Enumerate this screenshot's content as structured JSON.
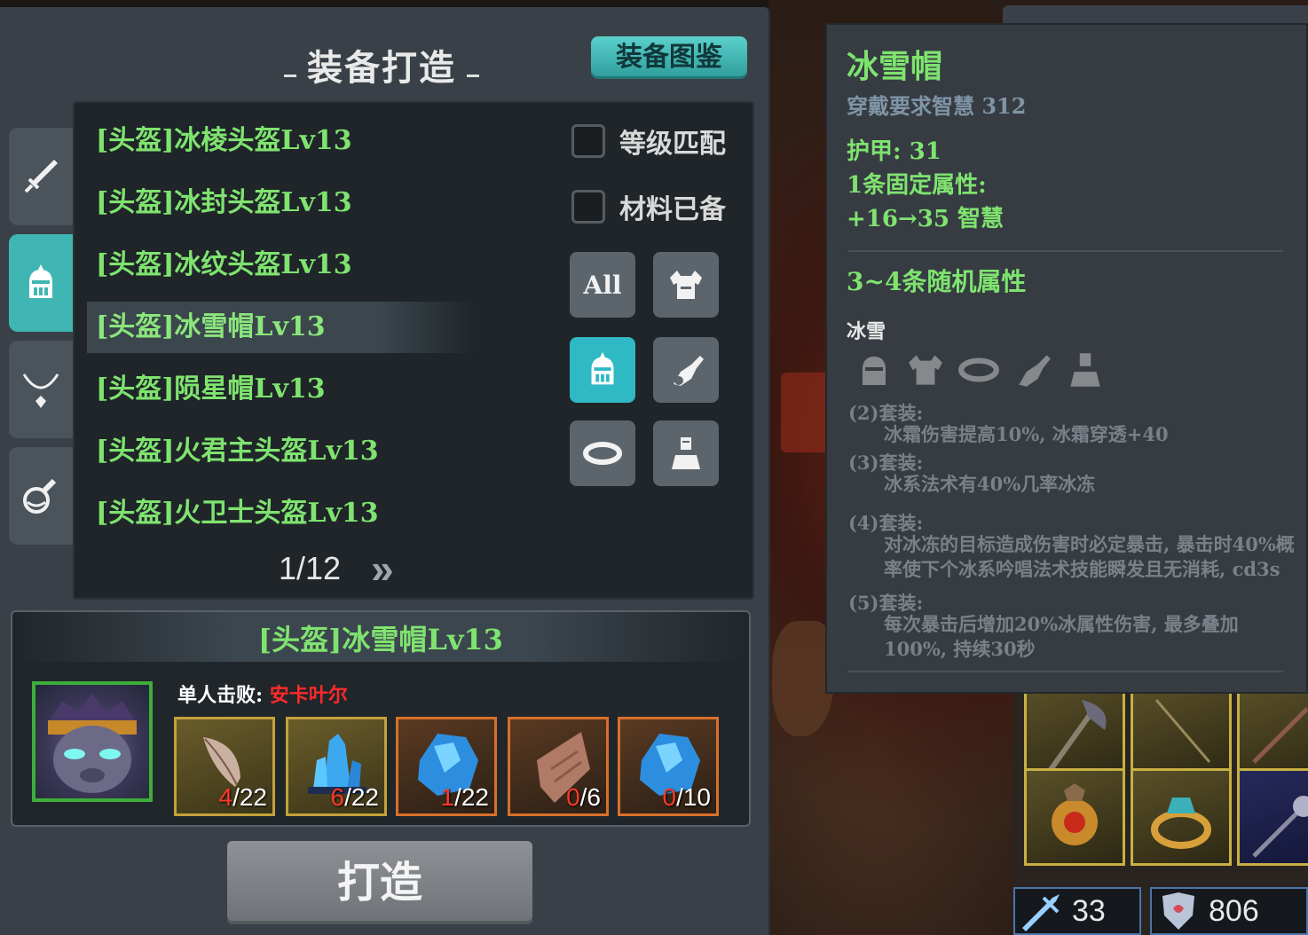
{
  "crafting": {
    "title": "装备打造",
    "codex_button": "装备图鉴",
    "category_tabs": [
      {
        "name": "weapon",
        "icon": "sword-icon",
        "active": false
      },
      {
        "name": "helmet",
        "icon": "helmet-icon",
        "active": true
      },
      {
        "name": "necklace",
        "icon": "necklace-icon",
        "active": false
      },
      {
        "name": "potion",
        "icon": "potion-icon",
        "active": false
      }
    ],
    "recipes": [
      {
        "label": "[头盔]冰棱头盔Lv13",
        "selected": false
      },
      {
        "label": "[头盔]冰封头盔Lv13",
        "selected": false
      },
      {
        "label": "[头盔]冰纹头盔Lv13",
        "selected": false
      },
      {
        "label": "[头盔]冰雪帽Lv13",
        "selected": true
      },
      {
        "label": "[头盔]陨星帽Lv13",
        "selected": false
      },
      {
        "label": "[头盔]火君主头盔Lv13",
        "selected": false
      },
      {
        "label": "[头盔]火卫士头盔Lv13",
        "selected": false
      }
    ],
    "checkboxes": {
      "level_match": {
        "label": "等级匹配",
        "checked": false
      },
      "materials_ready": {
        "label": "材料已备",
        "checked": false
      }
    },
    "filters": {
      "all_label": "All",
      "buttons": [
        {
          "icon": "shoulder-armor-icon",
          "active": false
        },
        {
          "icon": "helmet-icon",
          "active": true
        },
        {
          "icon": "gauntlet-icon",
          "active": false
        },
        {
          "icon": "ring-icon",
          "active": false
        },
        {
          "icon": "body-armor-icon",
          "active": false
        }
      ]
    },
    "pagination": {
      "text": "1/12",
      "next": "»"
    },
    "materials": {
      "title": "[头盔]冰雪帽Lv13",
      "boss_prefix": "单人击败:",
      "boss_name": "安卡叶尔",
      "items": [
        {
          "icon": "feather-icon",
          "have": "4",
          "need": "/22",
          "rarity": "common"
        },
        {
          "icon": "blue-crystal-icon",
          "have": "6",
          "need": "/22",
          "rarity": "common"
        },
        {
          "icon": "ice-ore-icon",
          "have": "1",
          "need": "/22",
          "rarity": "rare"
        },
        {
          "icon": "hide-icon",
          "have": "0",
          "need": "/6",
          "rarity": "rare"
        },
        {
          "icon": "ice-ore-icon",
          "have": "0",
          "need": "/10",
          "rarity": "rare"
        }
      ]
    },
    "craft_button": "打造"
  },
  "tooltip": {
    "name": "冰雪帽",
    "requirement": "穿戴要求智慧  312",
    "armor": "护甲:   31",
    "fixed_attr_title": "1条固定属性:",
    "fixed_attr_value": "+16→35  智慧",
    "random_attr": "3~4条随机属性",
    "set_name": "冰雪",
    "set_icons": [
      "helmet-icon",
      "shoulder-armor-icon",
      "ring-icon",
      "gauntlet-icon",
      "body-armor-icon"
    ],
    "set_bonuses": [
      {
        "head": "(2)套装:",
        "text": "冰霜伤害提高10%, 冰霜穿透+40"
      },
      {
        "head": "(3)套装:",
        "text": "冰系法术有40%几率冰冻"
      },
      {
        "head": "(4)套装:",
        "text": "对冰冻的目标造成伤害时必定暴击, 暴击时40%概率使下个冰系吟唱法术技能瞬发且无消耗, cd3s"
      },
      {
        "head": "(5)套装:",
        "text": "每次暴击后增加20%冰属性伤害, 最多叠加100%, 持续30秒"
      }
    ]
  },
  "inventory": {
    "slots": [
      {
        "icon": "axe-icon"
      },
      {
        "icon": "staff-icon"
      },
      {
        "icon": "spear-icon"
      },
      {
        "icon": "amulet-icon"
      },
      {
        "icon": "ring-icon"
      },
      {
        "icon": "mace-icon"
      }
    ],
    "stats": [
      {
        "icon": "attack-icon",
        "value": "33"
      },
      {
        "icon": "defense-icon",
        "value": "806"
      }
    ]
  }
}
